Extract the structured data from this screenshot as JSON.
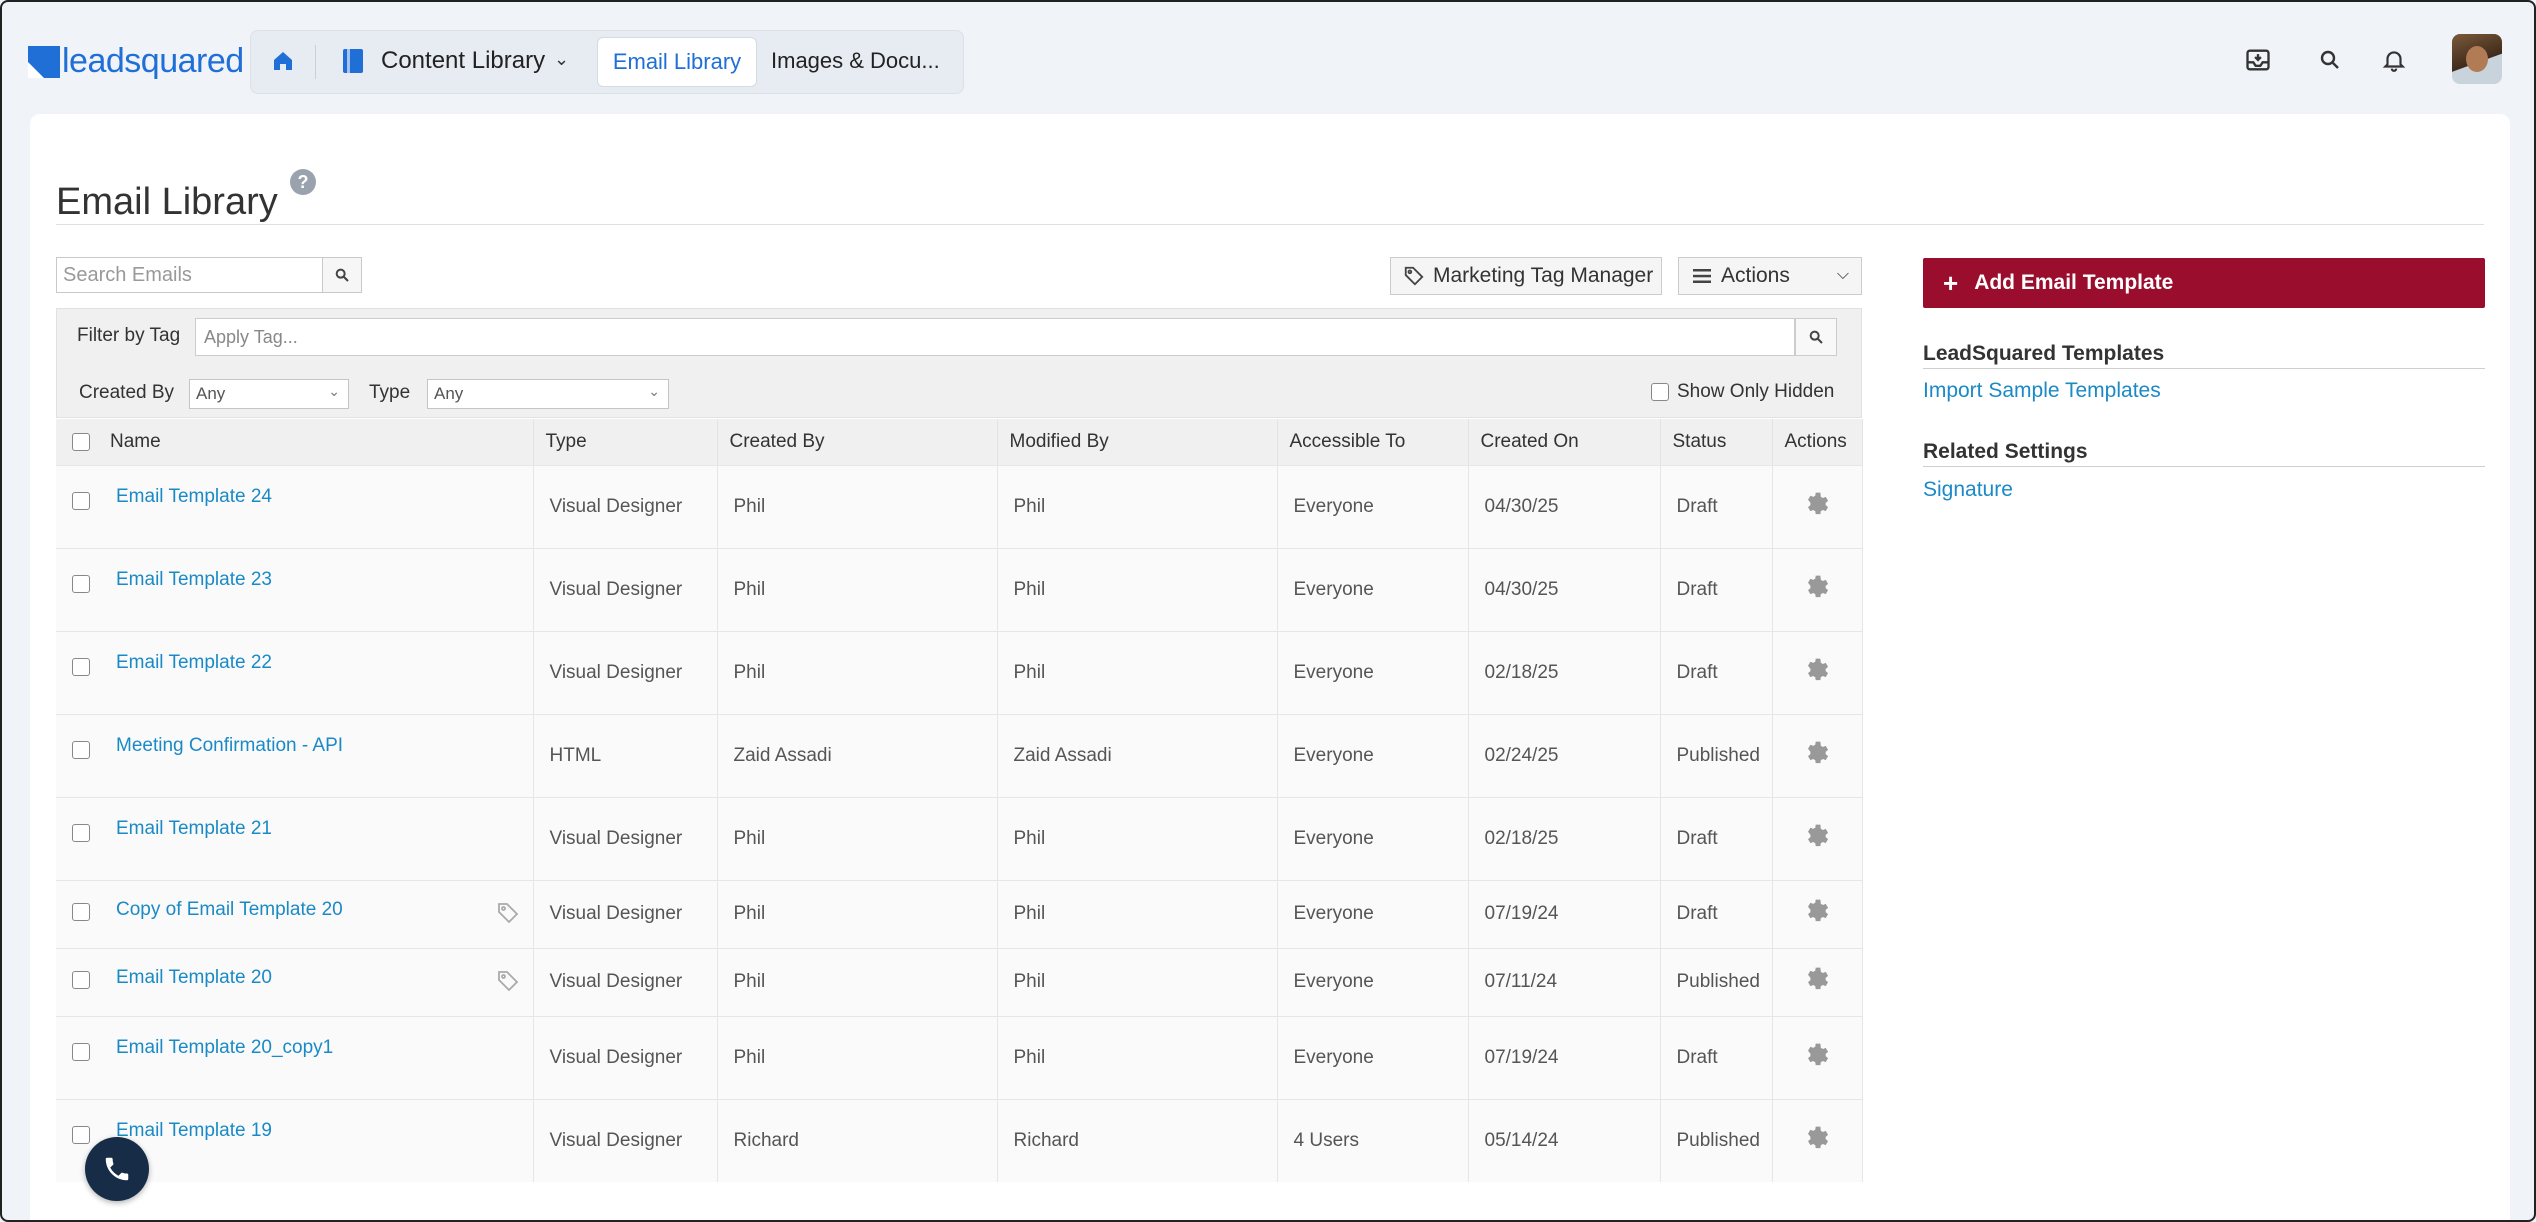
{
  "brand": {
    "logo_text": "leadsquared",
    "accent": "#1f6fd6",
    "primary_button": "#9b0d2d"
  },
  "nav": {
    "module_label": "Content Library",
    "tabs": [
      {
        "label": "Email Library",
        "active": true
      },
      {
        "label": "Images & Docu...",
        "active": false
      }
    ]
  },
  "page": {
    "title": "Email Library"
  },
  "toolbar": {
    "search_placeholder": "Search Emails",
    "marketing_tag_label": "Marketing Tag Manager",
    "actions_label": "Actions"
  },
  "filters": {
    "tag_label": "Filter by Tag",
    "tag_placeholder": "Apply Tag...",
    "created_by_label": "Created By",
    "created_by_value": "Any",
    "type_label": "Type",
    "type_value": "Any",
    "show_hidden_label": "Show Only Hidden"
  },
  "table": {
    "headers": [
      "Name",
      "Type",
      "Created By",
      "Modified By",
      "Accessible To",
      "Created On",
      "Status",
      "Actions"
    ],
    "rows": [
      {
        "name": "Email Template 24",
        "type": "Visual Designer",
        "created_by": "Phil",
        "modified_by": "Phil",
        "accessible_to": "Everyone",
        "created_on": "04/30/25",
        "status": "Draft"
      },
      {
        "name": "Email Template 23",
        "type": "Visual Designer",
        "created_by": "Phil",
        "modified_by": "Phil",
        "accessible_to": "Everyone",
        "created_on": "04/30/25",
        "status": "Draft"
      },
      {
        "name": "Email Template 22",
        "type": "Visual Designer",
        "created_by": "Phil",
        "modified_by": "Phil",
        "accessible_to": "Everyone",
        "created_on": "02/18/25",
        "status": "Draft"
      },
      {
        "name": "Meeting Confirmation - API",
        "type": "HTML",
        "created_by": "Zaid Assadi",
        "modified_by": "Zaid Assadi",
        "accessible_to": "Everyone",
        "created_on": "02/24/25",
        "status": "Published"
      },
      {
        "name": "Email Template 21",
        "type": "Visual Designer",
        "created_by": "Phil",
        "modified_by": "Phil",
        "accessible_to": "Everyone",
        "created_on": "02/18/25",
        "status": "Draft"
      },
      {
        "name": "Copy of Email Template 20",
        "type": "Visual Designer",
        "created_by": "Phil",
        "modified_by": "Phil",
        "accessible_to": "Everyone",
        "created_on": "07/19/24",
        "status": "Draft"
      },
      {
        "name": "Email Template 20",
        "type": "Visual Designer",
        "created_by": "Phil",
        "modified_by": "Phil",
        "accessible_to": "Everyone",
        "created_on": "07/11/24",
        "status": "Published"
      },
      {
        "name": "Email Template 20_copy1",
        "type": "Visual Designer",
        "created_by": "Phil",
        "modified_by": "Phil",
        "accessible_to": "Everyone",
        "created_on": "07/19/24",
        "status": "Draft"
      },
      {
        "name": "Email Template 19",
        "type": "Visual Designer",
        "created_by": "Richard",
        "modified_by": "Richard",
        "accessible_to": "4 Users",
        "created_on": "05/14/24",
        "status": "Published"
      }
    ]
  },
  "side": {
    "add_button": "Add Email Template",
    "templates_heading": "LeadSquared Templates",
    "import_link": "Import Sample Templates",
    "related_heading": "Related Settings",
    "signature_link": "Signature"
  }
}
